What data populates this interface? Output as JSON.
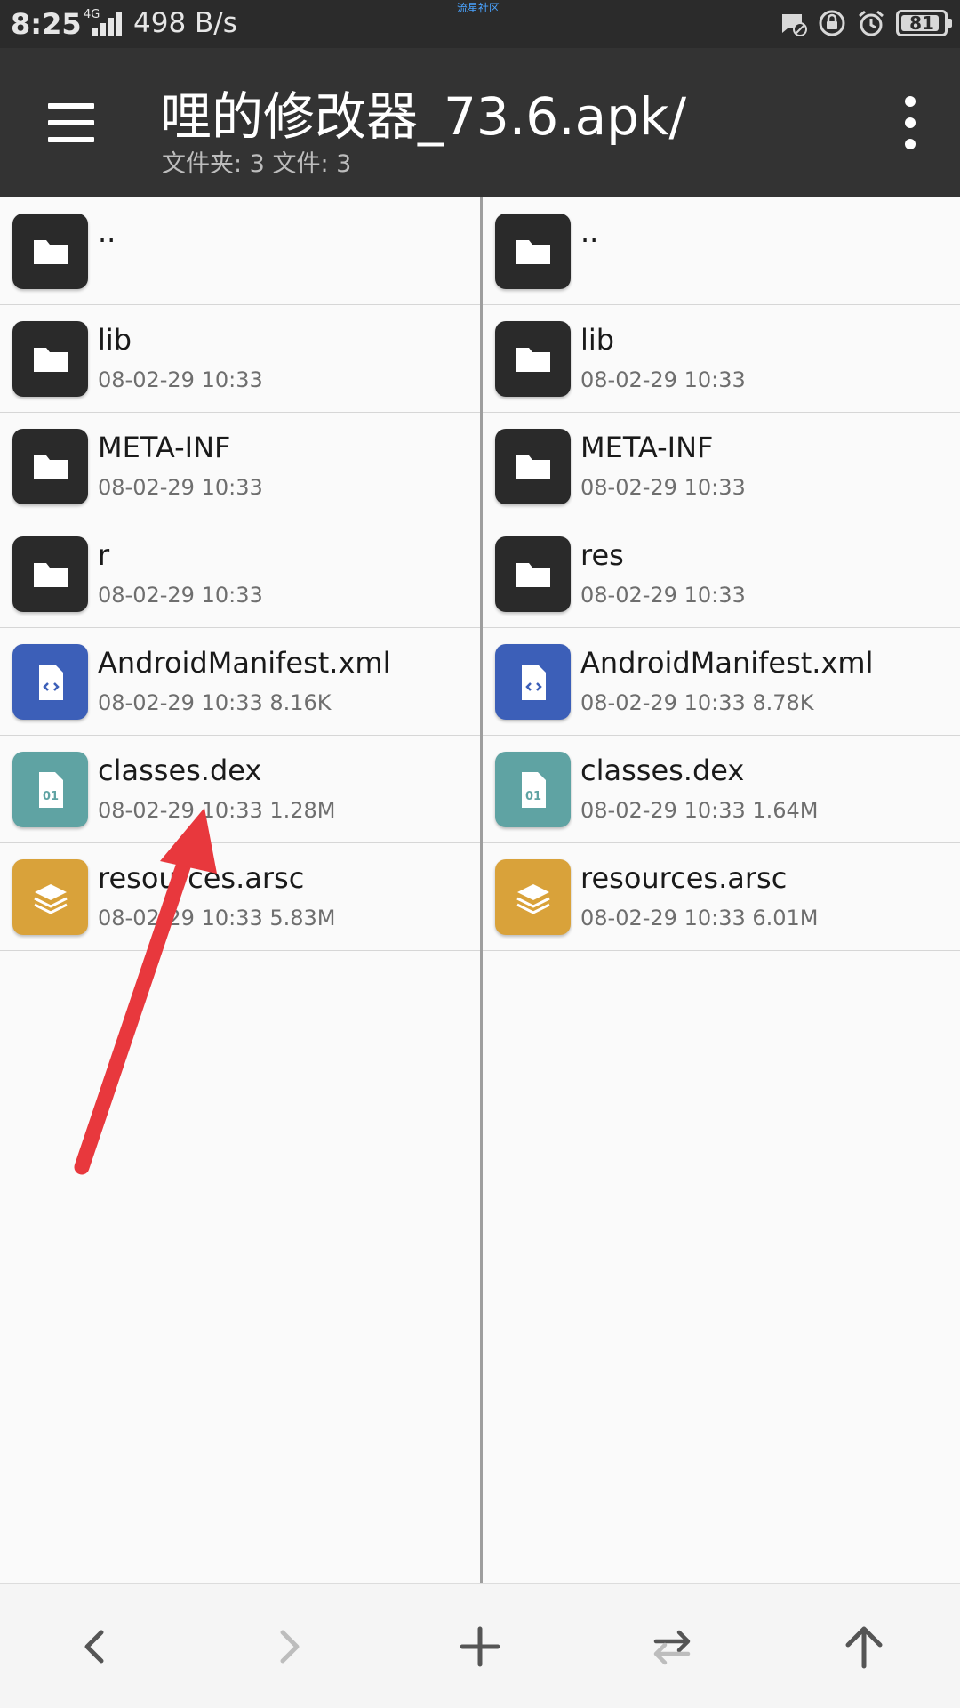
{
  "status_bar": {
    "time": "8:25",
    "network": "4G",
    "speed": "498 B/s",
    "watermark": "流星社区",
    "battery": "81",
    "icons": [
      "notification-off-icon",
      "lock-rotation-icon",
      "alarm-icon",
      "battery-icon"
    ]
  },
  "app_bar": {
    "title": "哩的修改器_73.6.apk/",
    "subtitle": "文件夹: 3  文件: 3",
    "menu_icon": "hamburger-menu-icon",
    "overflow_icon": "more-vertical-icon"
  },
  "left_pane": {
    "items": [
      {
        "name": "..",
        "meta": "",
        "type": "folder"
      },
      {
        "name": "lib",
        "meta": "08-02-29 10:33",
        "type": "folder"
      },
      {
        "name": "META-INF",
        "meta": "08-02-29 10:33",
        "type": "folder"
      },
      {
        "name": "r",
        "meta": "08-02-29 10:33",
        "type": "folder"
      },
      {
        "name": "AndroidManifest.xml",
        "meta": "08-02-29 10:33   8.16K",
        "type": "xml"
      },
      {
        "name": "classes.dex",
        "meta": "08-02-29 10:33   1.28M",
        "type": "dex"
      },
      {
        "name": "resources.arsc",
        "meta": "08-02-29 10:33   5.83M",
        "type": "arsc"
      }
    ]
  },
  "right_pane": {
    "items": [
      {
        "name": "..",
        "meta": "",
        "type": "folder"
      },
      {
        "name": "lib",
        "meta": "08-02-29 10:33",
        "type": "folder"
      },
      {
        "name": "META-INF",
        "meta": "08-02-29 10:33",
        "type": "folder"
      },
      {
        "name": "res",
        "meta": "08-02-29 10:33",
        "type": "folder"
      },
      {
        "name": "AndroidManifest.xml",
        "meta": "08-02-29 10:33   8.78K",
        "type": "xml"
      },
      {
        "name": "classes.dex",
        "meta": "08-02-29 10:33   1.64M",
        "type": "dex"
      },
      {
        "name": "resources.arsc",
        "meta": "08-02-29 10:33   6.01M",
        "type": "arsc"
      }
    ]
  },
  "bottom_bar": {
    "buttons": [
      "back-arrow-icon",
      "forward-arrow-icon",
      "add-icon",
      "swap-icon",
      "up-arrow-icon"
    ]
  },
  "colors": {
    "folder": "#2a2a2a",
    "xml": "#3c5fb8",
    "dex": "#5fa3a3",
    "arsc": "#d9a23a",
    "annotation": "#e8383d"
  }
}
